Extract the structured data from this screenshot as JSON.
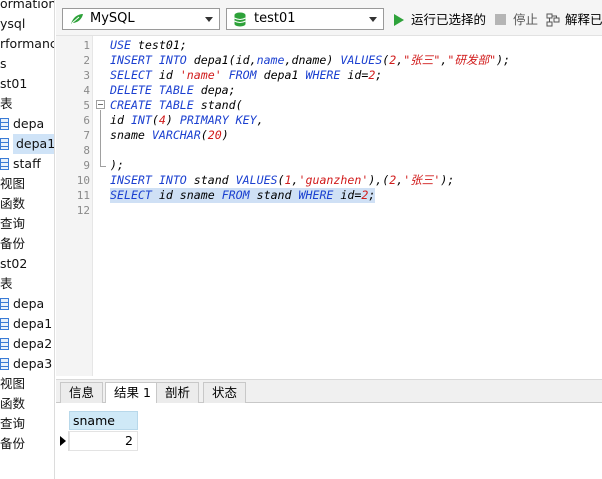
{
  "tree": {
    "items": [
      {
        "label": "ormation_",
        "icon": "none"
      },
      {
        "label": "ysql",
        "icon": "none"
      },
      {
        "label": "rformanc",
        "icon": "none"
      },
      {
        "label": "s",
        "icon": "none"
      },
      {
        "label": "st01",
        "icon": "none"
      },
      {
        "label": "表",
        "icon": "none"
      },
      {
        "label": "depa",
        "icon": "table-icon"
      },
      {
        "label": "depa1",
        "icon": "table-icon",
        "selected": true
      },
      {
        "label": "staff",
        "icon": "table-icon"
      },
      {
        "label": "视图",
        "icon": "none"
      },
      {
        "label": "函数",
        "icon": "none"
      },
      {
        "label": "查询",
        "icon": "none"
      },
      {
        "label": "备份",
        "icon": "none"
      },
      {
        "label": "st02",
        "icon": "none"
      },
      {
        "label": "表",
        "icon": "none"
      },
      {
        "label": "depa",
        "icon": "table-icon"
      },
      {
        "label": "depa1",
        "icon": "table-icon"
      },
      {
        "label": "depa2",
        "icon": "table-icon"
      },
      {
        "label": "depa3",
        "icon": "table-icon"
      },
      {
        "label": "视图",
        "icon": "none"
      },
      {
        "label": "函数",
        "icon": "none"
      },
      {
        "label": "查询",
        "icon": "none"
      },
      {
        "label": "备份",
        "icon": "none"
      }
    ]
  },
  "toolbar": {
    "connection": "MySQL",
    "database": "test01",
    "run_selected": "运行已选择的",
    "stop": "停止",
    "explain": "解释已"
  },
  "editor": {
    "lines": [
      {
        "n": "1",
        "html": "<span class=\"kw\">USE</span> test01;"
      },
      {
        "n": "2",
        "html": "<span class=\"kw\">INSERT INTO</span> depa1(id,<span class=\"kw\">name</span>,dname) <span class=\"kw\">VALUES</span>(<span class=\"num\">2</span>,<span class=\"str\">\"张三\"</span>,<span class=\"str\">\"研发部\"</span>);"
      },
      {
        "n": "3",
        "html": "<span class=\"kw\">SELECT</span> id <span class=\"str\">'name'</span> <span class=\"kw\">FROM</span> depa1 <span class=\"kw\">WHERE</span> id=<span class=\"num\">2</span>;"
      },
      {
        "n": "4",
        "html": "<span class=\"kw\">DELETE TABLE</span> depa;"
      },
      {
        "n": "5",
        "html": "<span class=\"kw\">CREATE TABLE</span> stand("
      },
      {
        "n": "6",
        "html": "id <span class=\"kw\">INT</span>(<span class=\"num\">4</span>) <span class=\"kw\">PRIMARY KEY</span>,"
      },
      {
        "n": "7",
        "html": "sname <span class=\"kw\">VARCHAR</span>(<span class=\"num\">20</span>)"
      },
      {
        "n": "8",
        "html": ""
      },
      {
        "n": "9",
        "html": ");"
      },
      {
        "n": "10",
        "html": "<span class=\"kw\">INSERT INTO</span> stand <span class=\"kw\">VALUES</span>(<span class=\"num\">1</span>,<span class=\"str\">'guanzhen'</span>),(<span class=\"num\">2</span>,<span class=\"str\">'张三'</span>);"
      },
      {
        "n": "11",
        "html": "<span class=\"kw\">SELECT</span> id sname <span class=\"kw\">FROM</span> stand <span class=\"kw\">WHERE</span> id=<span class=\"num\">2</span>;",
        "highlight": true
      },
      {
        "n": "12",
        "html": ""
      }
    ]
  },
  "result_tabs": [
    {
      "label": "信息",
      "active": false
    },
    {
      "label": "结果 1",
      "active": true
    },
    {
      "label": "剖析",
      "active": false
    },
    {
      "label": "状态",
      "active": false
    }
  ],
  "result_grid": {
    "columns": [
      "sname"
    ],
    "rows": [
      [
        "2"
      ]
    ]
  }
}
